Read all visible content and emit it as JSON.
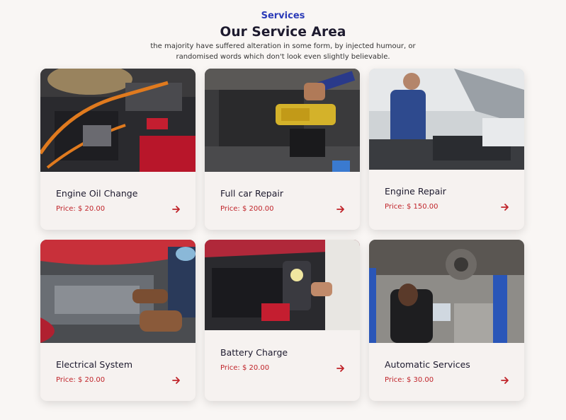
{
  "header": {
    "eyebrow": "Services",
    "title": "Our Service Area",
    "subtitle": "the majority have suffered alteration in some form, by injected humour, or randomised words which don't look even slightly believable."
  },
  "colors": {
    "accent": "#c0242a",
    "eyebrow": "#2b3bb8",
    "background": "#f9f6f4"
  },
  "services": [
    {
      "name": "Engine Oil Change",
      "price": "Price: $ 20.00",
      "image": "engine-jumper-cables-photo",
      "icon": "arrow-right-icon"
    },
    {
      "name": "Full car Repair",
      "price": "Price: $ 200.00",
      "image": "pouring-motor-oil-photo",
      "icon": "arrow-right-icon"
    },
    {
      "name": "Engine Repair",
      "price": "Price: $ 150.00",
      "image": "mechanic-under-hood-photo",
      "icon": "arrow-right-icon"
    },
    {
      "name": "Electrical System",
      "price": "Price: $ 20.00",
      "image": "mechanic-hands-engine-photo",
      "icon": "arrow-right-icon"
    },
    {
      "name": "Battery Charge",
      "price": "Price: $ 20.00",
      "image": "battery-tester-photo",
      "icon": "arrow-right-icon"
    },
    {
      "name": "Automatic Services",
      "price": "Price: $ 30.00",
      "image": "brake-inspection-photo",
      "icon": "arrow-right-icon"
    }
  ]
}
